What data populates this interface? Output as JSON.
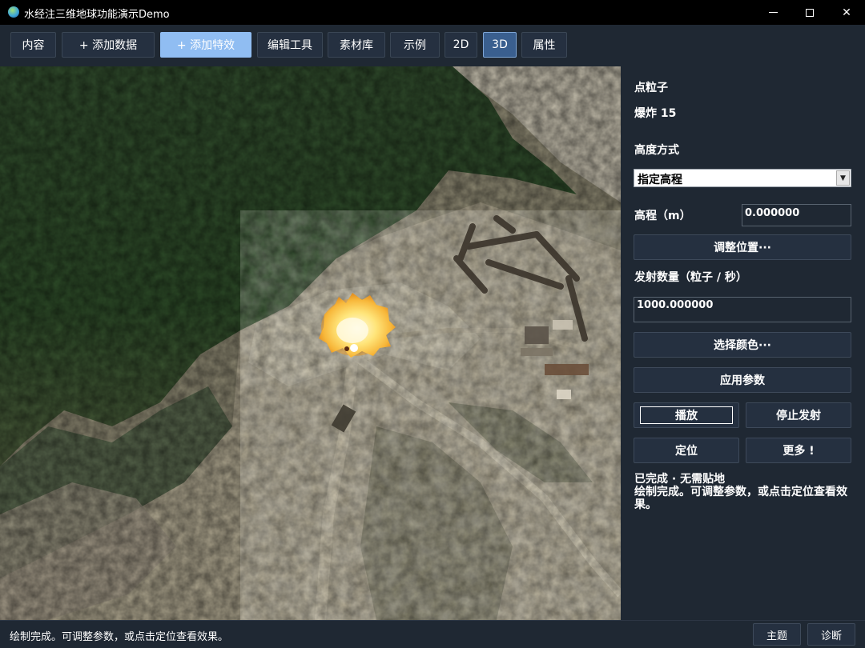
{
  "window": {
    "title": "水经注三维地球功能演示Demo",
    "minimize_glyph": "",
    "close_glyph": "✕"
  },
  "toolbar": {
    "content": "内容",
    "add_data": "+ 添加数据",
    "add_effect": "+ 添加特效",
    "edit_tools": "编辑工具",
    "materials": "素材库",
    "examples": "示例",
    "view_2d": "2D",
    "view_3d": "3D",
    "properties": "属性"
  },
  "panel": {
    "type_label": "点粒子",
    "name_label": "爆炸 15",
    "height_mode_label": "高度方式",
    "height_mode_value": "指定高程",
    "elevation_label": "高程（m）",
    "elevation_value": "0.000000",
    "adjust_position": "调整位置···",
    "emit_count_label": "发射数量（粒子 / 秒）",
    "emit_count_value": "1000.000000",
    "select_color": "选择颜色···",
    "apply_params": "应用参数",
    "play": "播放",
    "stop_emit": "停止发射",
    "locate": "定位",
    "more": "更多 !",
    "status_line1": "已完成 · 无需贴地",
    "status_line2": "绘制完成。可调整参数，或点击定位查看效果。"
  },
  "statusbar": {
    "message": "绘制完成。可调整参数，或点击定位查看效果。",
    "theme": "主题",
    "diagnose": "诊断"
  },
  "icons": {
    "app": "globe-icon",
    "dropdown": "chevron-down-icon"
  },
  "colors": {
    "background": "#1f2833",
    "button": "#253040",
    "accent_blue": "#90bdf2",
    "selected_3d": "#3a5f8f"
  }
}
